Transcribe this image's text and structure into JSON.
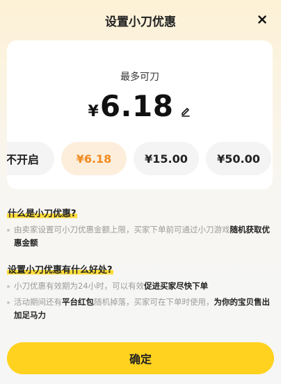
{
  "header": {
    "title": "设置小刀优惠"
  },
  "card": {
    "label": "最多可刀",
    "currency": "¥",
    "amount": "6.18"
  },
  "options": [
    {
      "label": "不开启",
      "selected": false
    },
    {
      "label": "¥6.18",
      "selected": true
    },
    {
      "label": "¥15.00",
      "selected": false
    },
    {
      "label": "¥50.00",
      "selected": false
    }
  ],
  "faq": {
    "q1": "什么是小刀优惠?",
    "a1": {
      "plain": "由卖家设置可小刀优惠金额上限，买家下单前可通过小刀游戏",
      "bold": "随机获取优惠金额"
    },
    "q2": "设置小刀优惠有什么好处?",
    "a2": {
      "plain": "小刀优惠有效期为24小时，可以有效",
      "bold": "促进买家尽快下单"
    },
    "a3": {
      "plain1": "活动期间还有",
      "bold1": "平台红包",
      "plain2": "随机掉落，买家可在下单时使用，",
      "bold2": "为你的宝贝售出加足马力"
    }
  },
  "confirm_label": "确定",
  "colors": {
    "accent": "#ffd21f",
    "selected_text": "#f28a1e",
    "selected_bg": "#fdeedc"
  }
}
